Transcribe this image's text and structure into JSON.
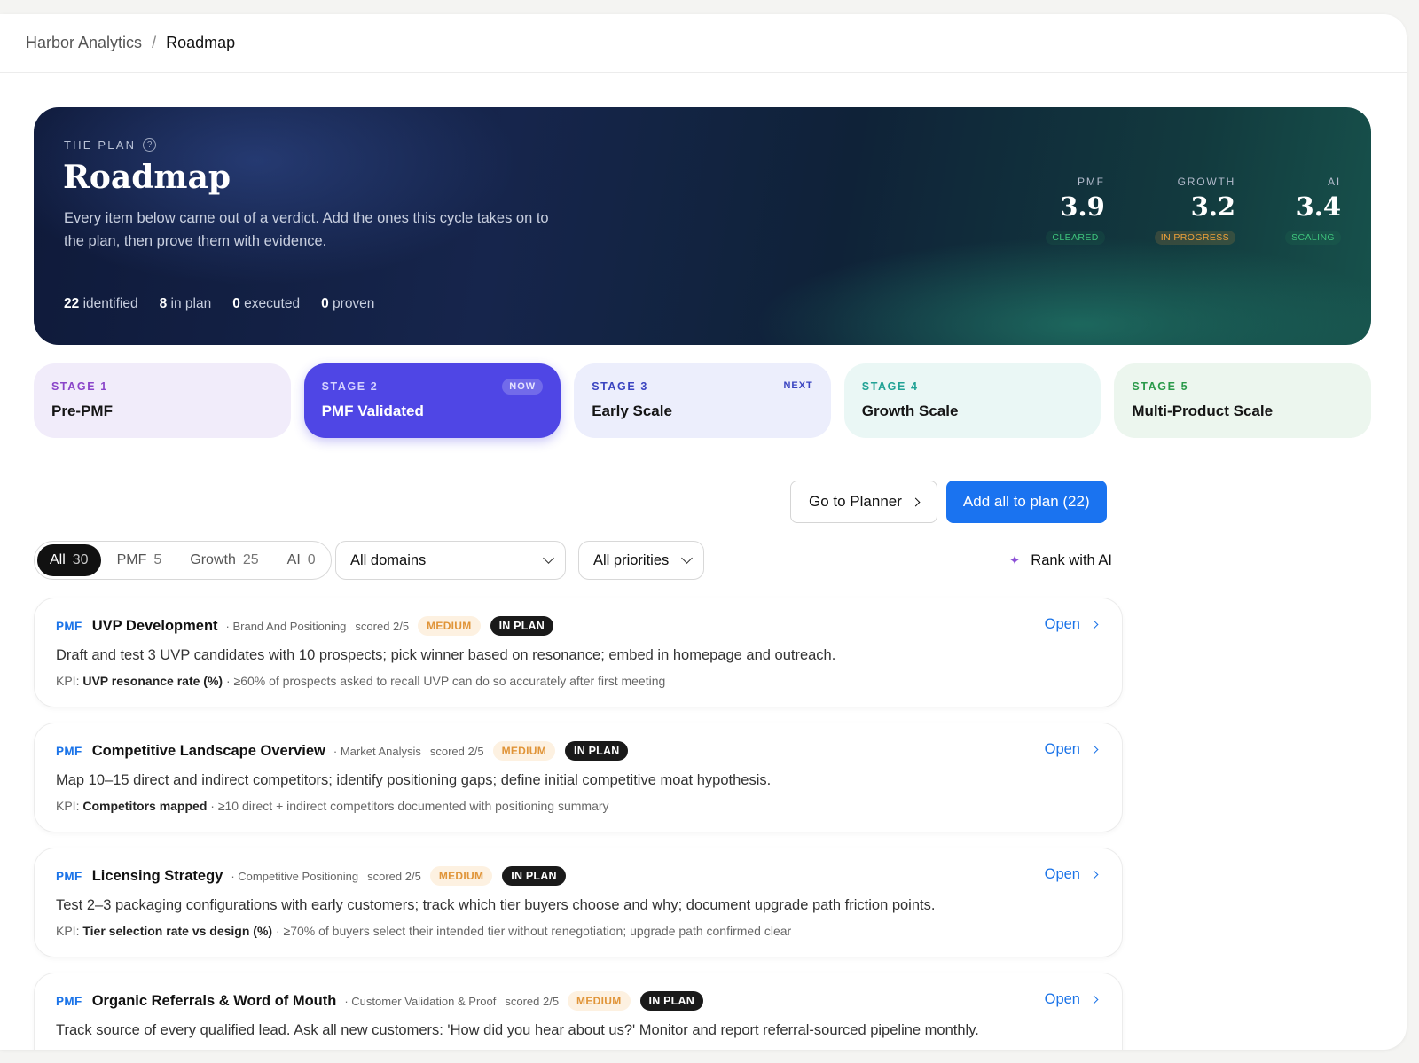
{
  "breadcrumb": {
    "root": "Harbor Analytics",
    "separator": "/",
    "current": "Roadmap"
  },
  "hero": {
    "eyebrow": "THE PLAN",
    "title": "Roadmap",
    "description": "Every item below came out of a verdict. Add the ones this cycle takes on to the plan, then prove them with evidence.",
    "stats": [
      {
        "value": "22",
        "label": "identified"
      },
      {
        "value": "8",
        "label": "in plan"
      },
      {
        "value": "0",
        "label": "executed"
      },
      {
        "value": "0",
        "label": "proven"
      }
    ],
    "scores": [
      {
        "label": "PMF",
        "value": "3.9",
        "status": "CLEARED",
        "status_color": "#3fc47c"
      },
      {
        "label": "GROWTH",
        "value": "3.2",
        "status": "IN PROGRESS",
        "status_color": "#f0a23a"
      },
      {
        "label": "AI",
        "value": "3.4",
        "status": "SCALING",
        "status_color": "#3fc47c"
      }
    ]
  },
  "stages": [
    {
      "num": "STAGE 1",
      "name": "Pre-PMF",
      "tag": ""
    },
    {
      "num": "STAGE 2",
      "name": "PMF Validated",
      "tag": "NOW"
    },
    {
      "num": "STAGE 3",
      "name": "Early Scale",
      "tag": "NEXT"
    },
    {
      "num": "STAGE 4",
      "name": "Growth Scale",
      "tag": ""
    },
    {
      "num": "STAGE 5",
      "name": "Multi-Product Scale",
      "tag": ""
    }
  ],
  "actions": {
    "planner_label": "Go to Planner",
    "add_all_label": "Add all to plan (22)"
  },
  "filters": {
    "segments": [
      {
        "label": "All",
        "count": "30",
        "active": true
      },
      {
        "label": "PMF",
        "count": "5",
        "active": false
      },
      {
        "label": "Growth",
        "count": "25",
        "active": false
      },
      {
        "label": "AI",
        "count": "0",
        "active": false
      }
    ],
    "domain_select": "All domains",
    "priority_select": "All priorities",
    "rank_label": "Rank with AI"
  },
  "items": [
    {
      "domain": "PMF",
      "title": "UVP Development",
      "category": "· Brand And Positioning",
      "score": "scored 2/5",
      "priority": "MEDIUM",
      "status": "IN PLAN",
      "open_label": "Open",
      "description": "Draft and test 3 UVP candidates with 10 prospects; pick winner based on resonance; embed in homepage and outreach.",
      "kpi_prefix": "KPI:",
      "kpi_name": "UVP resonance rate (%)",
      "kpi_target": " · ≥60% of prospects asked to recall UVP can do so accurately after first meeting"
    },
    {
      "domain": "PMF",
      "title": "Competitive Landscape Overview",
      "category": "· Market Analysis",
      "score": "scored 2/5",
      "priority": "MEDIUM",
      "status": "IN PLAN",
      "open_label": "Open",
      "description": "Map 10–15 direct and indirect competitors; identify positioning gaps; define initial competitive moat hypothesis.",
      "kpi_prefix": "KPI:",
      "kpi_name": "Competitors mapped",
      "kpi_target": " · ≥10 direct + indirect competitors documented with positioning summary"
    },
    {
      "domain": "PMF",
      "title": "Licensing Strategy",
      "category": "· Competitive Positioning",
      "score": "scored 2/5",
      "priority": "MEDIUM",
      "status": "IN PLAN",
      "open_label": "Open",
      "description": "Test 2–3 packaging configurations with early customers; track which tier buyers choose and why; document upgrade path friction points.",
      "kpi_prefix": "KPI:",
      "kpi_name": "Tier selection rate vs design (%)",
      "kpi_target": " · ≥70% of buyers select their intended tier without renegotiation; upgrade path confirmed clear"
    },
    {
      "domain": "PMF",
      "title": "Organic Referrals & Word of Mouth",
      "category": "· Customer Validation & Proof",
      "score": "scored 2/5",
      "priority": "MEDIUM",
      "status": "IN PLAN",
      "open_label": "Open",
      "description": "Track source of every qualified lead. Ask all new customers: 'How did you hear about us?' Monitor and report referral-sourced pipeline monthly.",
      "kpi_prefix": "",
      "kpi_name": "",
      "kpi_target": ""
    }
  ]
}
